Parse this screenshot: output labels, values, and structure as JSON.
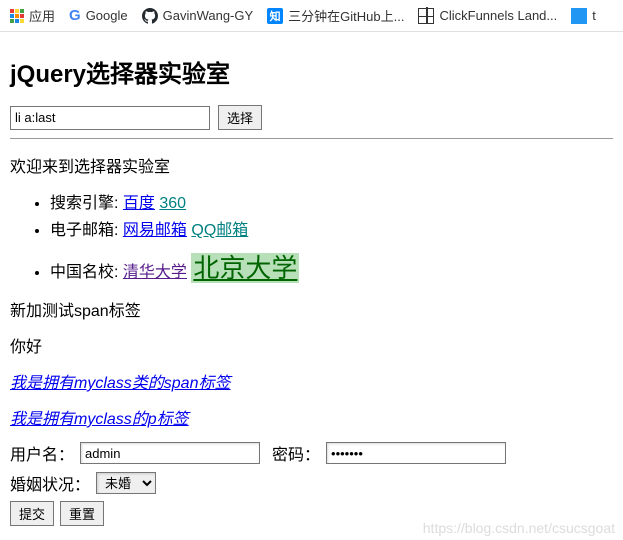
{
  "bookmarks": {
    "apps": "应用",
    "google": "Google",
    "gavin": "GavinWang-GY",
    "zhi_text": "知",
    "github_cn": "三分钟在GitHub上...",
    "clickfunnels": "ClickFunnels Land...",
    "last_partial": "t"
  },
  "page": {
    "title": "jQuery选择器实验室",
    "selector_value": "li a:last",
    "select_button": "选择",
    "welcome": "欢迎来到选择器实验室",
    "list": [
      {
        "label": "搜索引擎:",
        "links": [
          {
            "text": "百度",
            "class": ""
          },
          {
            "text": "360",
            "class": "teal"
          }
        ]
      },
      {
        "label": "电子邮箱:",
        "links": [
          {
            "text": "网易邮箱",
            "class": ""
          },
          {
            "text": "QQ邮箱",
            "class": "teal"
          }
        ]
      },
      {
        "label": "中国名校:",
        "links": [
          {
            "text": "清华大学",
            "class": "visited"
          },
          {
            "text": "北京大学",
            "class": "highlighted"
          }
        ]
      }
    ],
    "span_test": "新加测试span标签",
    "hello": "你好",
    "myclass_span": "我是拥有myclass类的span标签",
    "myclass_p": "我是拥有myclass的p标签",
    "form": {
      "username_label": "用户名：",
      "username_value": "admin",
      "password_label": "密码：",
      "password_value": "•••••••",
      "marital_label": "婚姻状况：",
      "marital_selected": "未婚",
      "submit": "提交",
      "reset": "重置"
    }
  },
  "watermark": "https://blog.csdn.net/csucsgoat"
}
